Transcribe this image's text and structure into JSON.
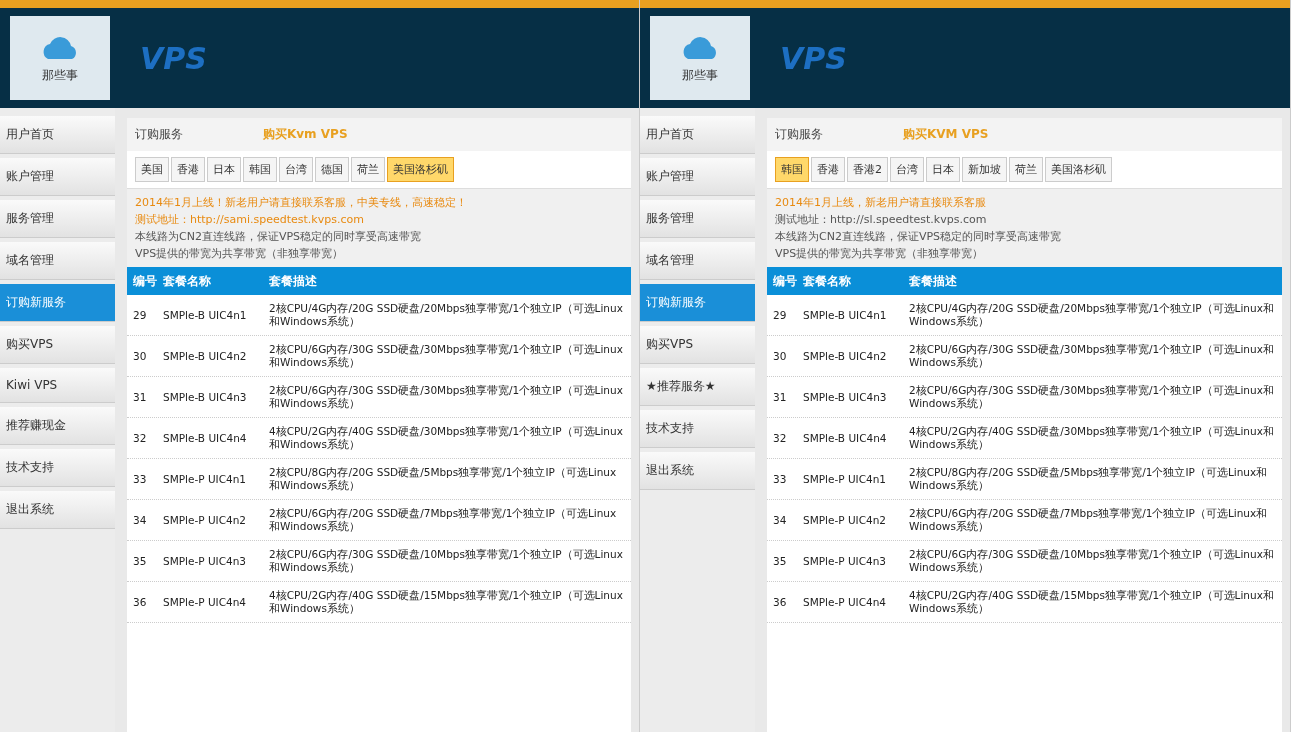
{
  "panes": [
    {
      "logo": "VPS",
      "logo_caption": "那些事",
      "sidebar": [
        {
          "label": "用户首页",
          "selected": false
        },
        {
          "label": "账户管理",
          "selected": false
        },
        {
          "label": "服务管理",
          "selected": false
        },
        {
          "label": "域名管理",
          "selected": false
        },
        {
          "label": "订购新服务",
          "selected": true
        },
        {
          "label": "购买VPS",
          "selected": false
        },
        {
          "label": "Kiwi VPS",
          "selected": false
        },
        {
          "label": "推荐赚现金",
          "selected": false
        },
        {
          "label": "技术支持",
          "selected": false
        },
        {
          "label": "退出系统",
          "selected": false
        }
      ],
      "breadcrumb": "订购服务",
      "title": "购买Kvm VPS",
      "tabs": [
        {
          "label": "美国",
          "selected": false
        },
        {
          "label": "香港",
          "selected": false
        },
        {
          "label": "日本",
          "selected": false
        },
        {
          "label": "韩国",
          "selected": false
        },
        {
          "label": "台湾",
          "selected": false
        },
        {
          "label": "德国",
          "selected": false
        },
        {
          "label": "荷兰",
          "selected": false
        },
        {
          "label": "美国洛杉矶",
          "selected": true
        }
      ],
      "notes": [
        {
          "text": "2014年1月上线！新老用户请直接联系客服，中美专线，高速稳定！",
          "kind": "highlight"
        },
        {
          "text": "测试地址：http://sami.speedtest.kvps.com",
          "kind": "highlight"
        },
        {
          "text": "本线路为CN2直连线路，保证VPS稳定的同时享受高速带宽",
          "kind": "plain"
        },
        {
          "text": "VPS提供的带宽为共享带宽（非独享带宽）",
          "kind": "plain"
        }
      ],
      "columns": [
        "编号",
        "套餐名称",
        "套餐描述"
      ],
      "rows": [
        {
          "id": "29",
          "name": "SMPle-B UIC4n1",
          "desc": "2核CPU/4G内存/20G SSD硬盘/20Mbps独享带宽/1个独立IP（可选Linux和Windows系统）"
        },
        {
          "id": "30",
          "name": "SMPle-B UIC4n2",
          "desc": "2核CPU/6G内存/30G SSD硬盘/30Mbps独享带宽/1个独立IP（可选Linux和Windows系统）"
        },
        {
          "id": "31",
          "name": "SMPle-B UIC4n3",
          "desc": "2核CPU/6G内存/30G SSD硬盘/30Mbps独享带宽/1个独立IP（可选Linux和Windows系统）"
        },
        {
          "id": "32",
          "name": "SMPle-B UIC4n4",
          "desc": "4核CPU/2G内存/40G SSD硬盘/30Mbps独享带宽/1个独立IP（可选Linux和Windows系统）"
        },
        {
          "id": "33",
          "name": "SMPle-P UIC4n1",
          "desc": "2核CPU/8G内存/20G SSD硬盘/5Mbps独享带宽/1个独立IP（可选Linux和Windows系统）"
        },
        {
          "id": "34",
          "name": "SMPle-P UIC4n2",
          "desc": "2核CPU/6G内存/20G SSD硬盘/7Mbps独享带宽/1个独立IP（可选Linux和Windows系统）"
        },
        {
          "id": "35",
          "name": "SMPle-P UIC4n3",
          "desc": "2核CPU/6G内存/30G SSD硬盘/10Mbps独享带宽/1个独立IP（可选Linux和Windows系统）"
        },
        {
          "id": "36",
          "name": "SMPle-P UIC4n4",
          "desc": "4核CPU/2G内存/40G SSD硬盘/15Mbps独享带宽/1个独立IP（可选Linux和Windows系统）"
        }
      ]
    },
    {
      "logo": "VPS",
      "logo_caption": "那些事",
      "sidebar": [
        {
          "label": "用户首页",
          "selected": false
        },
        {
          "label": "账户管理",
          "selected": false
        },
        {
          "label": "服务管理",
          "selected": false
        },
        {
          "label": "域名管理",
          "selected": false
        },
        {
          "label": "订购新服务",
          "selected": true
        },
        {
          "label": "购买VPS",
          "selected": false
        },
        {
          "label": "★推荐服务★",
          "selected": false
        },
        {
          "label": "技术支持",
          "selected": false
        },
        {
          "label": "退出系统",
          "selected": false
        }
      ],
      "breadcrumb": "订购服务",
      "title": "购买KVM VPS",
      "tabs": [
        {
          "label": "韩国",
          "selected": true
        },
        {
          "label": "香港",
          "selected": false
        },
        {
          "label": "香港2",
          "selected": false
        },
        {
          "label": "台湾",
          "selected": false
        },
        {
          "label": "日本",
          "selected": false
        },
        {
          "label": "新加坡",
          "selected": false
        },
        {
          "label": "荷兰",
          "selected": false
        },
        {
          "label": "美国洛杉矶",
          "selected": false
        }
      ],
      "notes": [
        {
          "text": "2014年1月上线，新老用户请直接联系客服",
          "kind": "highlight"
        },
        {
          "text": "测试地址：http://sl.speedtest.kvps.com",
          "kind": "plain"
        },
        {
          "text": "本线路为CN2直连线路，保证VPS稳定的同时享受高速带宽",
          "kind": "plain"
        },
        {
          "text": "VPS提供的带宽为共享带宽（非独享带宽）",
          "kind": "plain"
        }
      ],
      "columns": [
        "编号",
        "套餐名称",
        "套餐描述"
      ],
      "rows": [
        {
          "id": "29",
          "name": "SMPle-B UIC4n1",
          "desc": "2核CPU/4G内存/20G SSD硬盘/20Mbps独享带宽/1个独立IP（可选Linux和Windows系统）"
        },
        {
          "id": "30",
          "name": "SMPle-B UIC4n2",
          "desc": "2核CPU/6G内存/30G SSD硬盘/30Mbps独享带宽/1个独立IP（可选Linux和Windows系统）"
        },
        {
          "id": "31",
          "name": "SMPle-B UIC4n3",
          "desc": "2核CPU/6G内存/30G SSD硬盘/30Mbps独享带宽/1个独立IP（可选Linux和Windows系统）"
        },
        {
          "id": "32",
          "name": "SMPle-B UIC4n4",
          "desc": "4核CPU/2G内存/40G SSD硬盘/30Mbps独享带宽/1个独立IP（可选Linux和Windows系统）"
        },
        {
          "id": "33",
          "name": "SMPle-P UIC4n1",
          "desc": "2核CPU/8G内存/20G SSD硬盘/5Mbps独享带宽/1个独立IP（可选Linux和Windows系统）"
        },
        {
          "id": "34",
          "name": "SMPle-P UIC4n2",
          "desc": "2核CPU/6G内存/20G SSD硬盘/7Mbps独享带宽/1个独立IP（可选Linux和Windows系统）"
        },
        {
          "id": "35",
          "name": "SMPle-P UIC4n3",
          "desc": "2核CPU/6G内存/30G SSD硬盘/10Mbps独享带宽/1个独立IP（可选Linux和Windows系统）"
        },
        {
          "id": "36",
          "name": "SMPle-P UIC4n4",
          "desc": "4核CPU/2G内存/40G SSD硬盘/15Mbps独享带宽/1个独立IP（可选Linux和Windows系统）"
        }
      ]
    }
  ]
}
